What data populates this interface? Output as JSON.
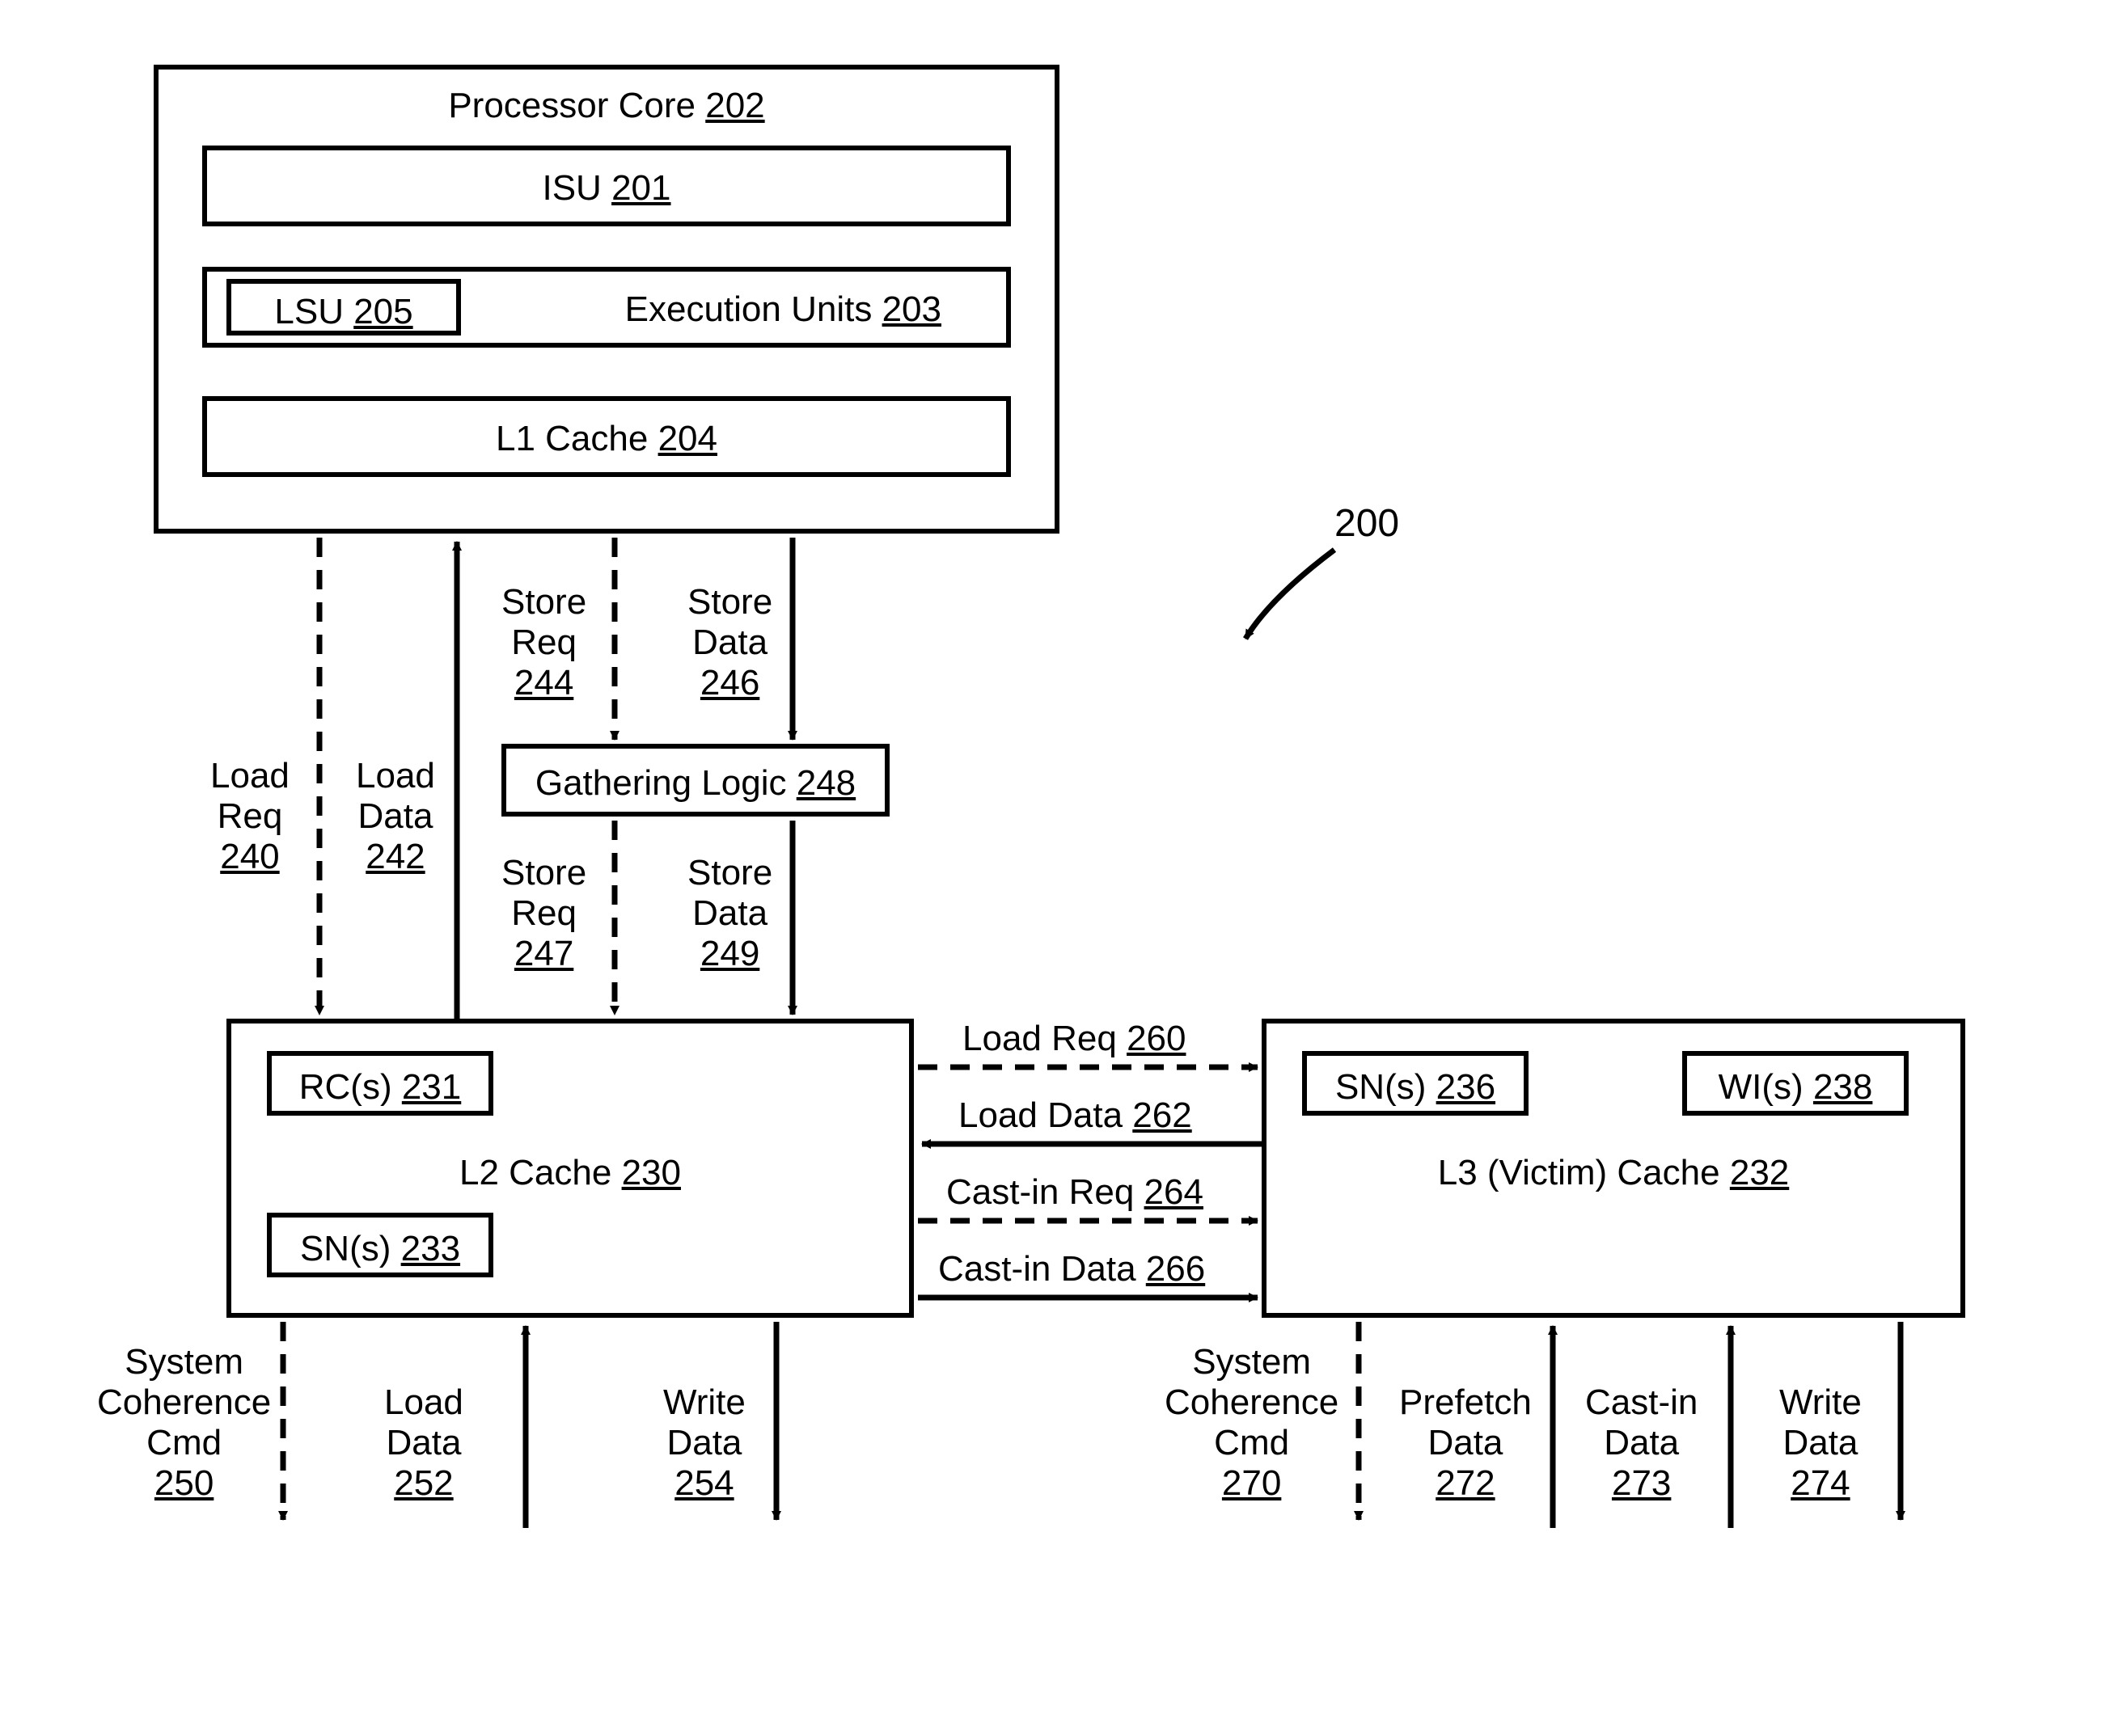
{
  "figure_ref": "200",
  "processor_core": {
    "label": "Processor Core",
    "ref": "202"
  },
  "isu": {
    "label": "ISU",
    "ref": "201"
  },
  "lsu": {
    "label": "LSU",
    "ref": "205"
  },
  "execution_units": {
    "label": "Execution Units",
    "ref": "203"
  },
  "l1_cache": {
    "label": "L1 Cache",
    "ref": "204"
  },
  "gathering_logic": {
    "label": "Gathering Logic",
    "ref": "248"
  },
  "l2_cache": {
    "label": "L2 Cache",
    "ref": "230"
  },
  "rc": {
    "label": "RC(s)",
    "ref": "231"
  },
  "sn_l2": {
    "label": "SN(s)",
    "ref": "233"
  },
  "l3_cache": {
    "label": "L3 (Victim) Cache",
    "ref": "232"
  },
  "sn_l3": {
    "label": "SN(s)",
    "ref": "236"
  },
  "wi": {
    "label": "WI(s)",
    "ref": "238"
  },
  "load_req_240": {
    "line1": "Load",
    "line2": "Req",
    "ref": "240"
  },
  "load_data_242": {
    "line1": "Load",
    "line2": "Data",
    "ref": "242"
  },
  "store_req_244": {
    "line1": "Store",
    "line2": "Req",
    "ref": "244"
  },
  "store_data_246": {
    "line1": "Store",
    "line2": "Data",
    "ref": "246"
  },
  "store_req_247": {
    "line1": "Store",
    "line2": "Req",
    "ref": "247"
  },
  "store_data_249": {
    "line1": "Store",
    "line2": "Data",
    "ref": "249"
  },
  "load_req_260": {
    "label": "Load Req",
    "ref": "260"
  },
  "load_data_262": {
    "label": "Load Data",
    "ref": "262"
  },
  "castin_req_264": {
    "label": "Cast-in Req",
    "ref": "264"
  },
  "castin_data_266": {
    "label": "Cast-in Data",
    "ref": "266"
  },
  "sys_coh_250": {
    "line1": "System",
    "line2": "Coherence",
    "line3": "Cmd",
    "ref": "250"
  },
  "load_data_252": {
    "line1": "Load",
    "line2": "Data",
    "ref": "252"
  },
  "write_data_254": {
    "line1": "Write",
    "line2": "Data",
    "ref": "254"
  },
  "sys_coh_270": {
    "line1": "System",
    "line2": "Coherence",
    "line3": "Cmd",
    "ref": "270"
  },
  "prefetch_272": {
    "line1": "Prefetch",
    "line2": "Data",
    "ref": "272"
  },
  "castin_273": {
    "line1": "Cast-in",
    "line2": "Data",
    "ref": "273"
  },
  "write_data_274": {
    "line1": "Write",
    "line2": "Data",
    "ref": "274"
  }
}
